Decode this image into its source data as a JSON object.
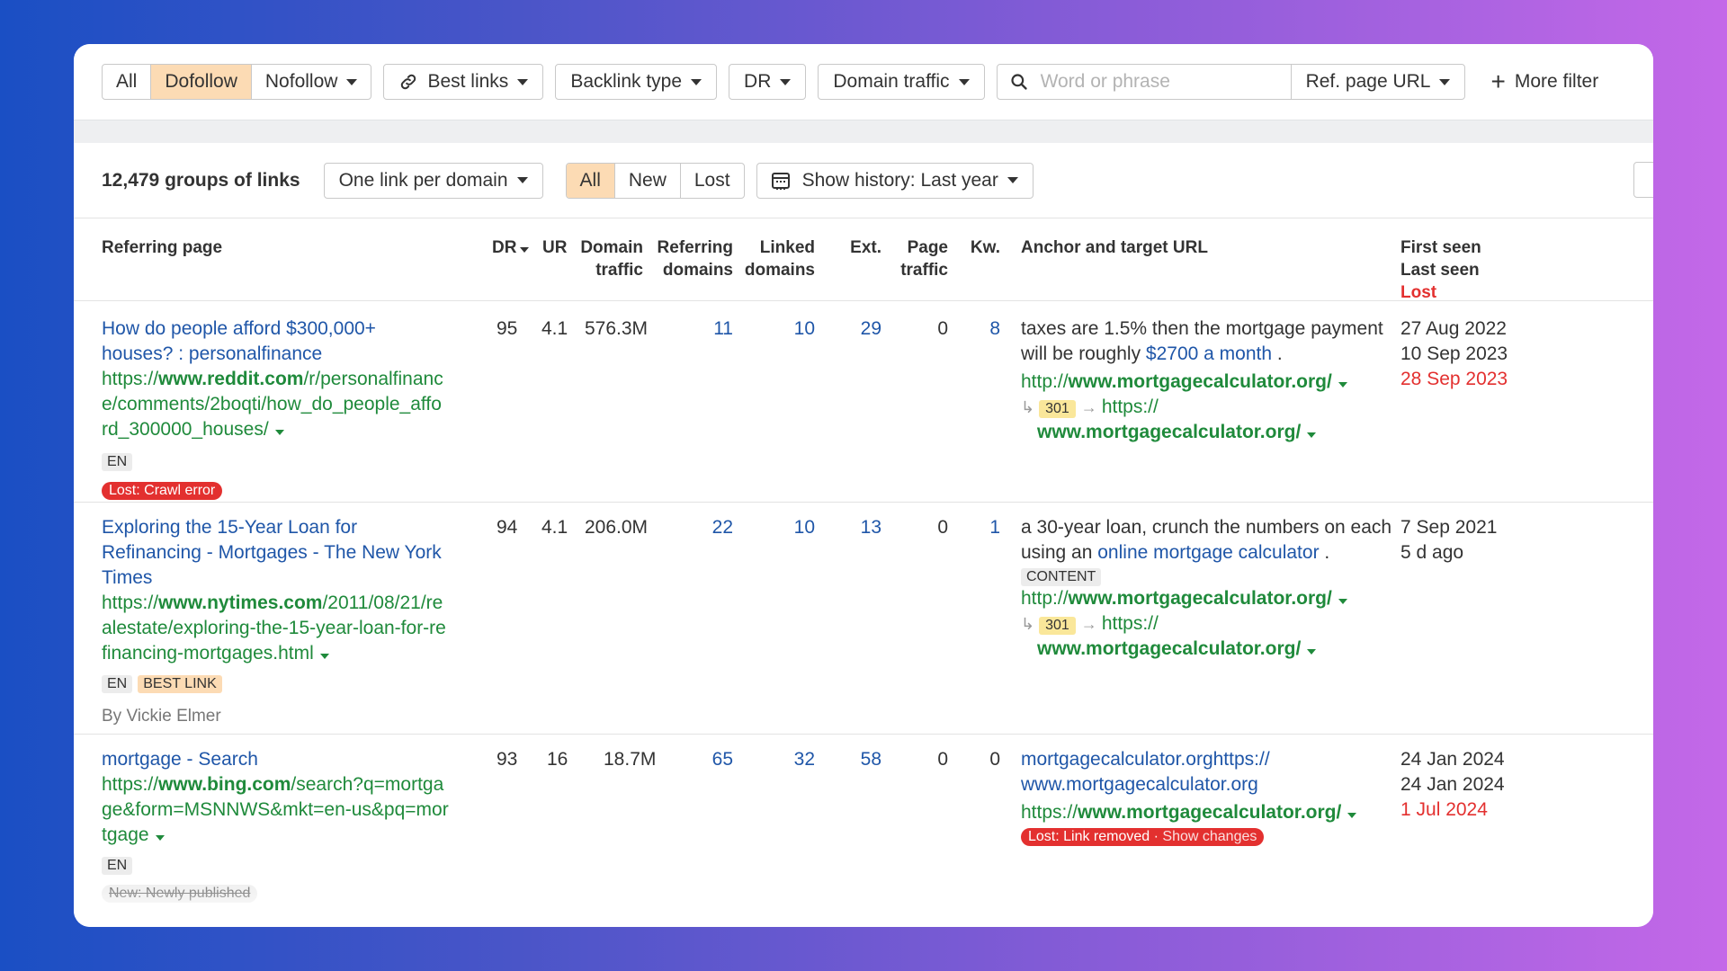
{
  "filters": {
    "link_type": [
      "All",
      "Dofollow",
      "Nofollow"
    ],
    "link_type_active": "Dofollow",
    "best_links": "Best links",
    "backlink_type": "Backlink type",
    "dr": "DR",
    "domain_traffic": "Domain traffic",
    "search_placeholder": "Word or phrase",
    "ref_page_url": "Ref. page URL",
    "more_filters": "More filter"
  },
  "toolbar": {
    "groups_count": "12,479 groups of links",
    "per_domain": "One link per domain",
    "status_tabs": [
      "All",
      "New",
      "Lost"
    ],
    "status_active": "All",
    "history": "Show history: Last year"
  },
  "columns": {
    "referring_page": "Referring page",
    "dr": "DR",
    "ur": "UR",
    "domain_traffic": [
      "Domain",
      "traffic"
    ],
    "referring_domains": [
      "Referring",
      "domains"
    ],
    "linked_domains": [
      "Linked",
      "domains"
    ],
    "ext": "Ext.",
    "page_traffic": [
      "Page",
      "traffic"
    ],
    "kw": "Kw.",
    "anchor": "Anchor and target URL",
    "first_seen": "First seen",
    "last_seen": "Last seen",
    "lost": "Lost"
  },
  "rows": [
    {
      "title": [
        "How do people afford $300,000+",
        "houses? : personalfinance"
      ],
      "url_prefix": "https://",
      "url_domain": "www.reddit.com",
      "url_path": [
        "/r/personalfinanc",
        "e/comments/2boqti/how_do_people_affo",
        "rd_300000_houses/"
      ],
      "lang": "EN",
      "status_badge": "Lost: Crawl error",
      "dr": "95",
      "ur": "4.1",
      "domain_traffic": "576.3M",
      "ref_domains": "11",
      "linked_domains": "10",
      "ext": "29",
      "page_traffic": "0",
      "kw": "8",
      "anchor_text_1": "taxes are 1.5% then the mortgage payment",
      "anchor_text_2": "will be roughly",
      "anchor_link": "$2700 a month",
      "anchor_after": " .",
      "target_prefix": "http://",
      "target_domain": "www.mortgagecalculator.org/",
      "redirect_code": "301",
      "redirect_prefix": "https://",
      "redirect_domain": "www.mortgagecalculator.org/",
      "first_seen": "27 Aug 2022",
      "last_seen": "10 Sep 2023",
      "lost_date": "28 Sep 2023"
    },
    {
      "title": [
        "Exploring the 15-Year Loan for",
        "Refinancing - Mortgages - The New York",
        "Times"
      ],
      "url_prefix": "https://",
      "url_domain": "www.nytimes.com",
      "url_path": [
        "/2011/08/21/re",
        "alestate/exploring-the-15-year-loan-for-re",
        "financing-mortgages.html"
      ],
      "lang": "EN",
      "best_badge": "BEST LINK",
      "author": "By Vickie Elmer",
      "dr": "94",
      "ur": "4.1",
      "domain_traffic": "206.0M",
      "ref_domains": "22",
      "linked_domains": "10",
      "ext": "13",
      "page_traffic": "0",
      "kw": "1",
      "anchor_text_1": "a 30-year loan, crunch the numbers on each",
      "anchor_text_2": "using an",
      "anchor_link": "online mortgage calculator",
      "anchor_after": " .",
      "content_badge": "CONTENT",
      "target_prefix": "http://",
      "target_domain": "www.mortgagecalculator.org/",
      "redirect_code": "301",
      "redirect_prefix": "https://",
      "redirect_domain": "www.mortgagecalculator.org/",
      "first_seen": "7 Sep 2021",
      "last_seen": "5 d ago"
    },
    {
      "title": [
        "mortgage - Search"
      ],
      "url_prefix": "https://",
      "url_domain": "www.bing.com",
      "url_path": [
        "/search?q=mortga",
        "ge&form=MSNNWS&mkt=en-us&pq=mor",
        "tgage"
      ],
      "lang": "EN",
      "new_badge": "New: Newly published",
      "dr": "93",
      "ur": "16",
      "domain_traffic": "18.7M",
      "ref_domains": "65",
      "linked_domains": "32",
      "ext": "58",
      "page_traffic": "0",
      "kw": "0",
      "anchor_link_1": "mortgagecalculator.orghttps://",
      "anchor_link_2": "www.mortgagecalculator.org",
      "target_prefix": "https://",
      "target_domain": "www.mortgagecalculator.org/",
      "lost_badge": "Lost: Link removed",
      "lost_badge_action": "Show changes",
      "first_seen": "24 Jan 2024",
      "last_seen": "24 Jan 2024",
      "lost_date": "1 Jul 2024"
    }
  ]
}
